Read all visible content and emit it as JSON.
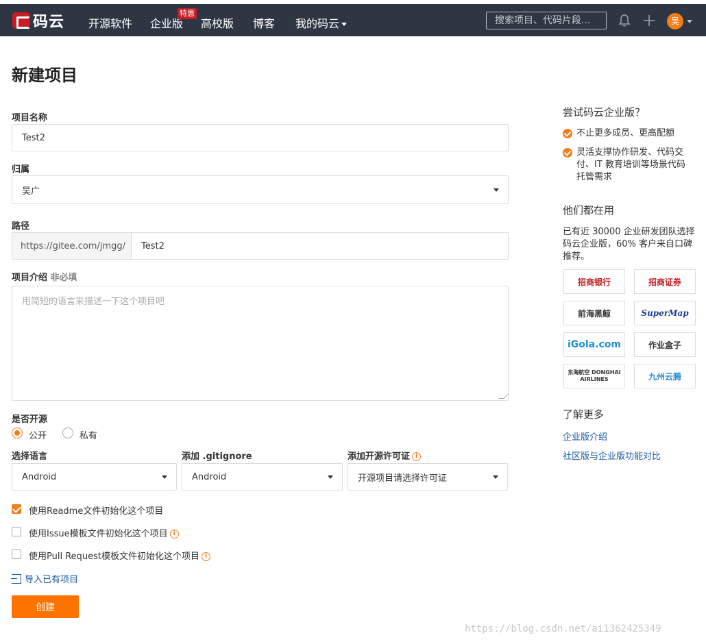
{
  "navbar": {
    "logo_text": "码云",
    "items": [
      "开源软件",
      "企业版",
      "高校版",
      "博客",
      "我的码云"
    ],
    "badge": "特惠",
    "search_placeholder": "搜索项目、代码片段...",
    "avatar_letter": "吴"
  },
  "form": {
    "title": "新建项目",
    "name_label": "项目名称",
    "name_value": "Test2",
    "owner_label": "归属",
    "owner_value": "吴广",
    "path_label": "路径",
    "path_prefix": "https://gitee.com/jmgg/",
    "path_value": "Test2",
    "desc_label": "项目介绍",
    "desc_optional": "非必填",
    "desc_placeholder": "用简短的语言来描述一下这个项目吧",
    "visibility_label": "是否开源",
    "public_label": "公开",
    "private_label": "私有",
    "language_label": "选择语言",
    "language_value": "Android",
    "gitignore_label": "添加 .gitignore",
    "gitignore_value": "Android",
    "license_label": "添加开源许可证",
    "license_value": "开源项目请选择许可证",
    "readme_label": "使用Readme文件初始化这个项目",
    "issue_label": "使用Issue模板文件初始化这个项目",
    "pr_label": "使用Pull Request模板文件初始化这个项目",
    "import_label": "导入已有项目",
    "create_button": "创建",
    "info_glyph": "i"
  },
  "sidebar": {
    "trial_heading": "尝试码云企业版？",
    "benefit1": "不止更多成员、更高配额",
    "benefit2_line1": "灵活支撑协作研发、代码交",
    "benefit2_line2": "付、IT 教育培训等场景代码",
    "benefit2_line3": "托管需求",
    "users_heading": "他们都在用",
    "users_para": "已有近 30000 企业研发团队选择码云企业版，60% 客户来自口碑推荐。",
    "logos": [
      "招商银行",
      "招商证券",
      "前海黑鲸",
      "SuperMap",
      "iGola.com",
      "作业盒子",
      "东海航空 DONGHAI AIRLINES",
      "九州云腾"
    ],
    "more_heading": "了解更多",
    "link1": "企业版介绍",
    "link2": "社区版与企业版功能对比"
  },
  "watermark": "https://blog.csdn.net/ai1362425349",
  "colors": {
    "navbar": "#2e3543",
    "accent": "#fe7300",
    "brand_red": "#c71d23",
    "link": "#1a5aa6"
  }
}
